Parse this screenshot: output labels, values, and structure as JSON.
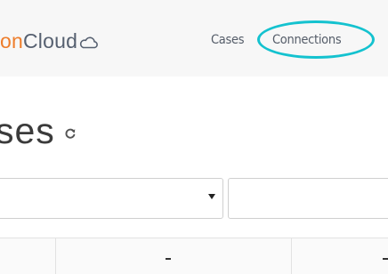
{
  "navbar": {
    "brand_accent": "on",
    "brand_main": "Cloud",
    "brand_icon": "cloud-icon",
    "links": [
      {
        "label": "Cases"
      },
      {
        "label": "Connections",
        "highlighted": true
      }
    ],
    "colors": {
      "accent": "#ee7d2b",
      "highlight": "#14c2cf",
      "background": "#f7f7f7"
    }
  },
  "page": {
    "title": "ses",
    "refresh_icon": "refresh-icon"
  },
  "filters": {
    "select_value": "",
    "select_icon": "caret-down-icon",
    "input_value": ""
  }
}
